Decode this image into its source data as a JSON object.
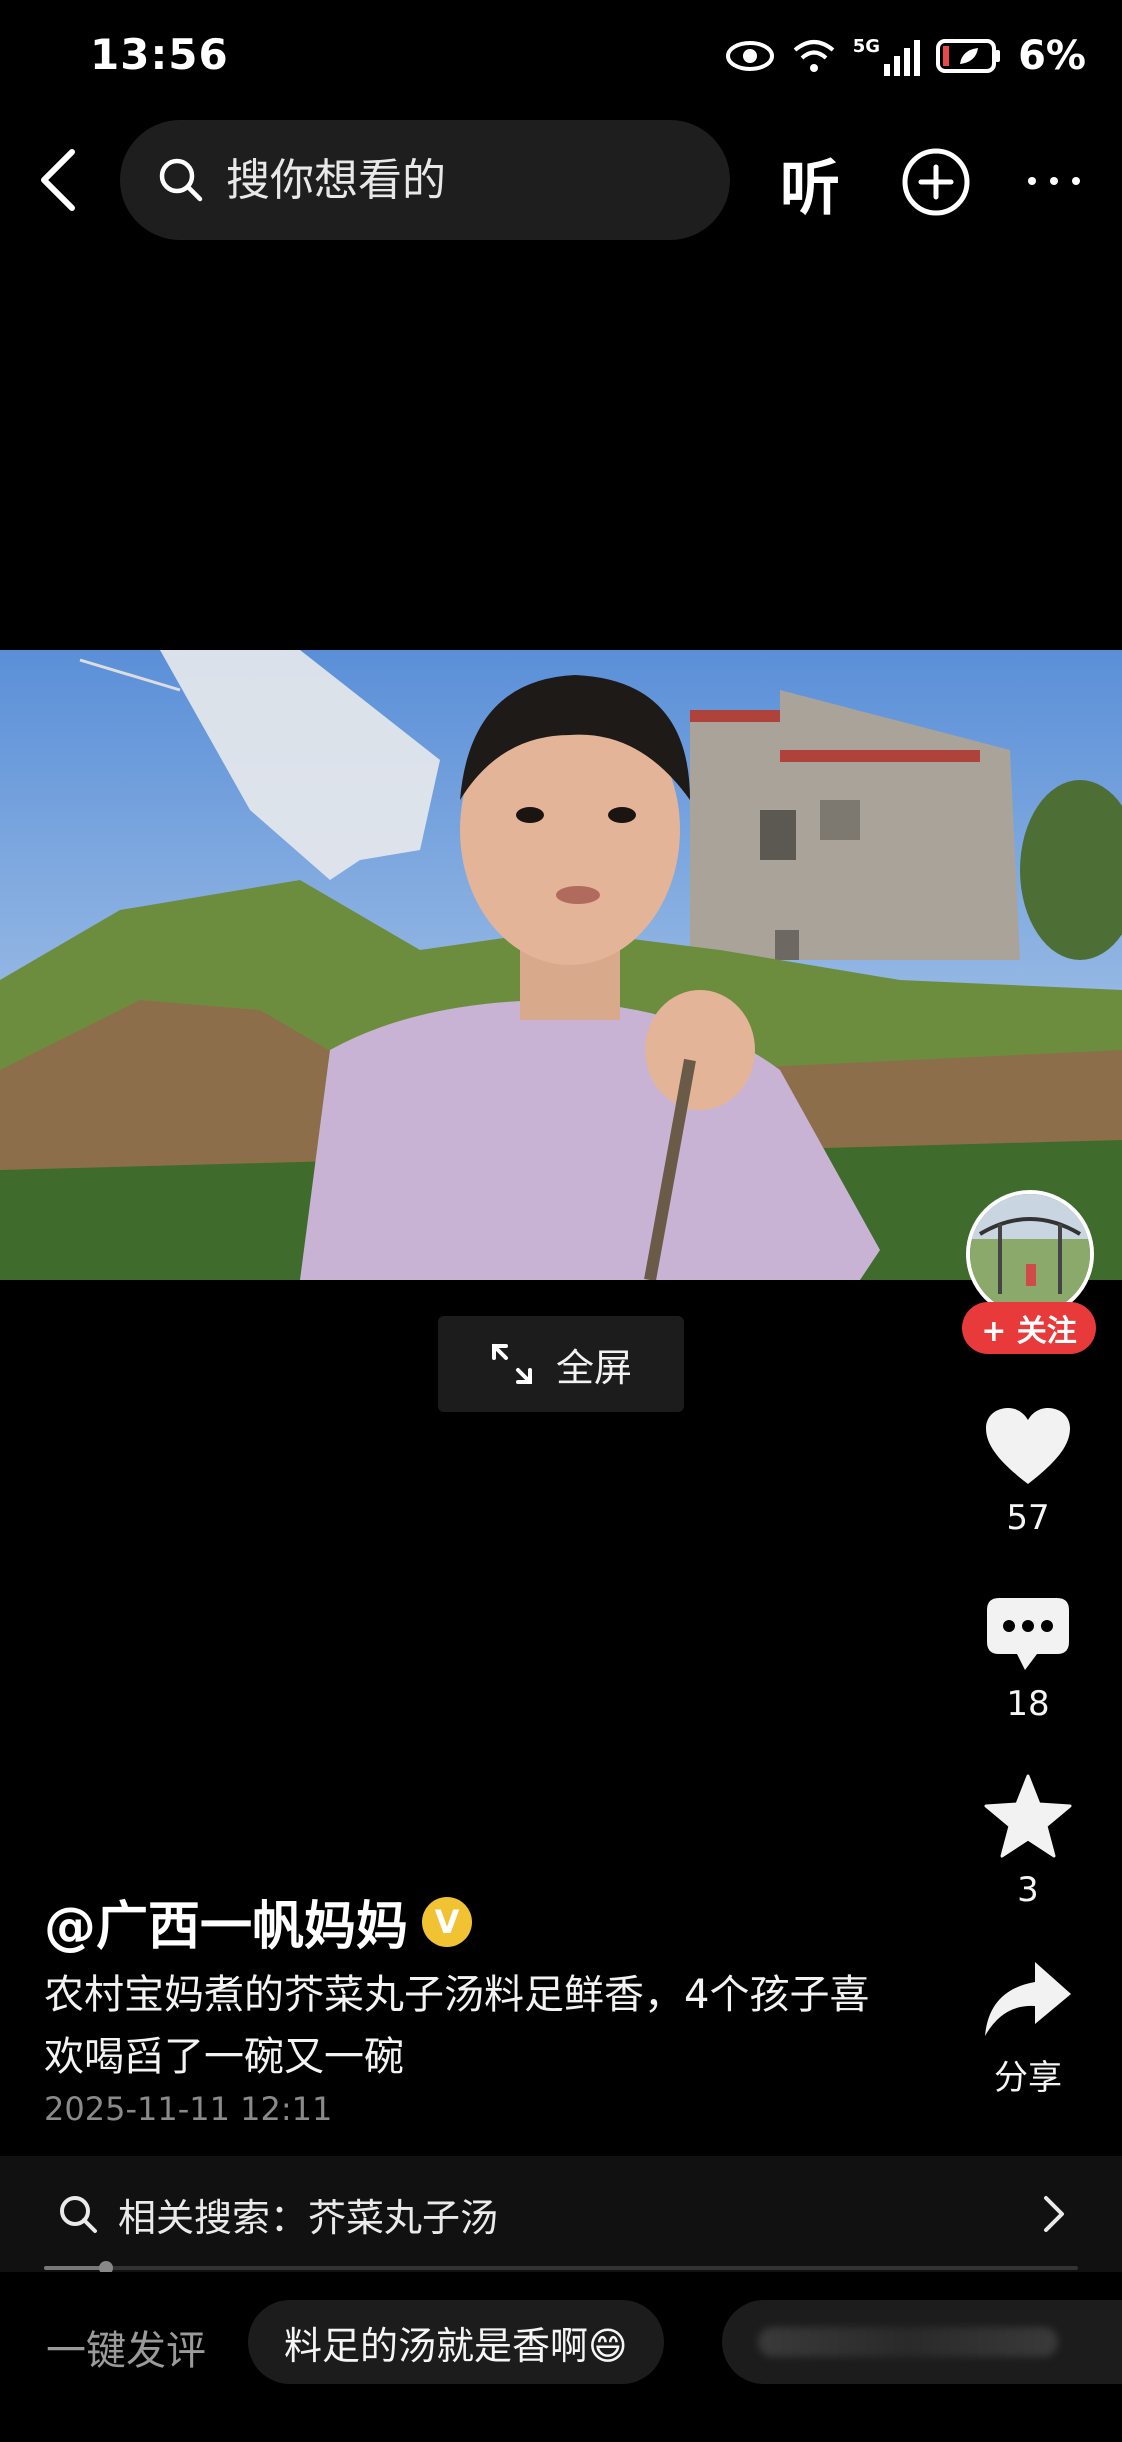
{
  "status_bar": {
    "time": "13:56",
    "network": "5G",
    "battery_percent": "6%"
  },
  "nav": {
    "search_placeholder": "搜你想看的",
    "listen_label": "听"
  },
  "video": {
    "fullscreen_label": "全屏"
  },
  "actions": {
    "follow_label": "+ 关注",
    "likes": "57",
    "comments": "18",
    "favorites": "3",
    "share_label": "分享"
  },
  "post": {
    "author": "@广西一帆妈妈",
    "verified_badge": "V",
    "description": "农村宝妈煮的芥菜丸子汤料足鲜香，4个孩子喜欢喝舀了一碗又一碗",
    "date": "2025-11-11 12:11"
  },
  "related_search": {
    "label": "相关搜索：芥菜丸子汤"
  },
  "playback": {
    "progress": 0.06
  },
  "comment_bar": {
    "quick_label": "一键发评",
    "suggestions": [
      "料足的汤就是香啊😄"
    ]
  },
  "colors": {
    "follow_red": "#e83a3a",
    "verified_gold": "#f1c232"
  }
}
